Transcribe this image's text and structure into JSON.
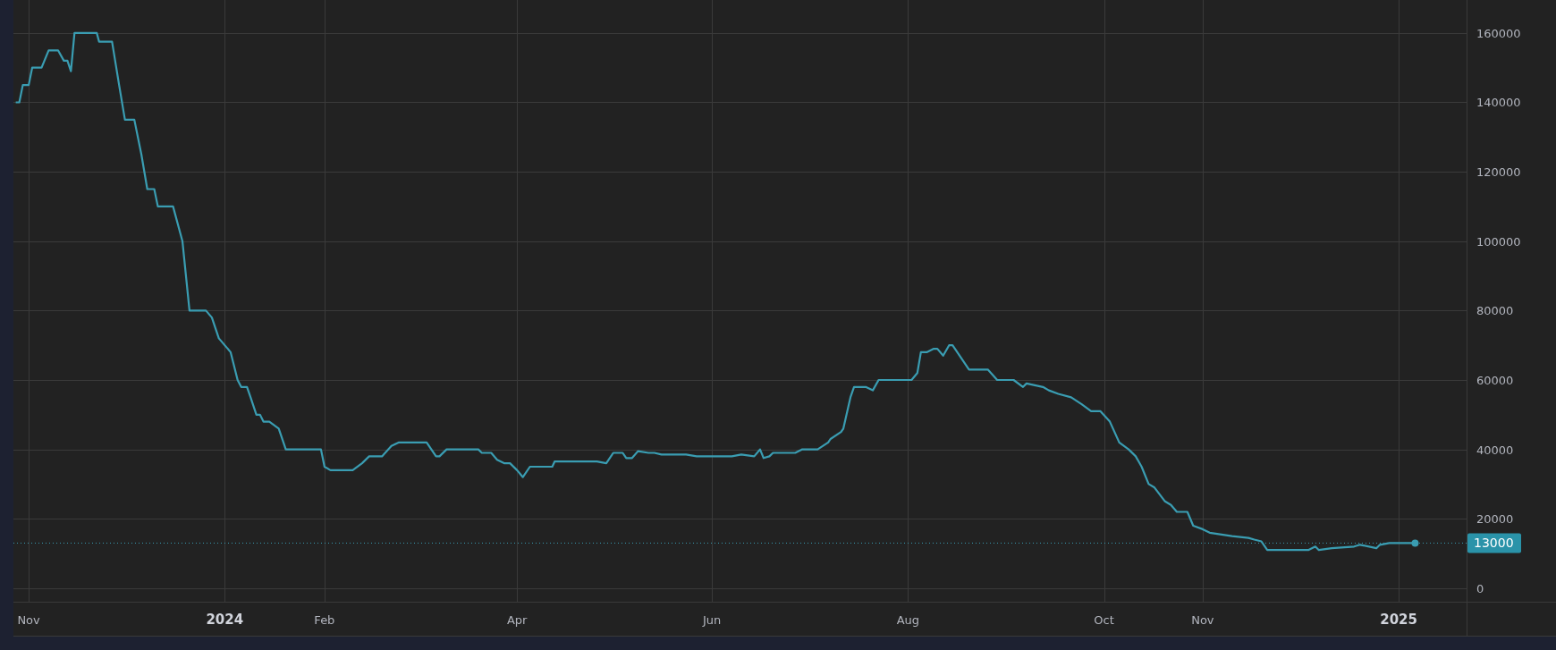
{
  "chart": {
    "x_tick_kinds": [
      {
        "kind": "month"
      },
      {
        "kind": "year"
      },
      {
        "kind": "month"
      },
      {
        "kind": "month"
      },
      {
        "kind": "month"
      },
      {
        "kind": "month"
      },
      {
        "kind": "month"
      },
      {
        "kind": "month"
      },
      {
        "kind": "year"
      }
    ],
    "chart_data": {
      "type": "line",
      "xlim": [
        2023.82,
        2025.134
      ],
      "ylim": [
        -3900,
        169500
      ],
      "xticks": [
        {
          "value": 2023.833,
          "label": "Nov"
        },
        {
          "value": 2024,
          "label": "2024"
        },
        {
          "value": 2024.085,
          "label": "Feb"
        },
        {
          "value": 2024.249,
          "label": "Apr"
        },
        {
          "value": 2024.415,
          "label": "Jun"
        },
        {
          "value": 2024.582,
          "label": "Aug"
        },
        {
          "value": 2024.749,
          "label": "Oct"
        },
        {
          "value": 2024.833,
          "label": "Nov"
        },
        {
          "value": 2025,
          "label": "2025"
        }
      ],
      "yticks": [
        0,
        20000,
        40000,
        60000,
        80000,
        100000,
        120000,
        140000,
        160000
      ],
      "series": [
        {
          "color": "#3a9db2",
          "x": [
            2023.822,
            2023.825,
            2023.828,
            2023.833,
            2023.836,
            2023.844,
            2023.85,
            2023.858,
            2023.863,
            2023.866,
            2023.869,
            2023.872,
            2023.891,
            2023.893,
            2023.904,
            2023.91,
            2023.915,
            2023.923,
            2023.929,
            2023.934,
            2023.94,
            2023.943,
            2023.956,
            2023.964,
            2023.97,
            2023.984,
            2023.989,
            2023.995,
            2024.005,
            2024.011,
            2024.014,
            2024.019,
            2024.022,
            2024.027,
            2024.03,
            2024.033,
            2024.038,
            2024.046,
            2024.052,
            2024.082,
            2024.085,
            2024.09,
            2024.109,
            2024.117,
            2024.123,
            2024.134,
            2024.142,
            2024.148,
            2024.172,
            2024.18,
            2024.183,
            2024.189,
            2024.216,
            2024.219,
            2024.227,
            2024.232,
            2024.238,
            2024.243,
            2024.249,
            2024.254,
            2024.26,
            2024.279,
            2024.281,
            2024.317,
            2024.325,
            2024.331,
            2024.339,
            2024.342,
            2024.347,
            2024.352,
            2024.361,
            2024.366,
            2024.372,
            2024.393,
            2024.402,
            2024.432,
            2024.44,
            2024.451,
            2024.456,
            2024.459,
            2024.464,
            2024.467,
            2024.486,
            2024.492,
            2024.505,
            2024.514,
            2024.516,
            2024.525,
            2024.527,
            2024.533,
            2024.536,
            2024.546,
            2024.552,
            2024.557,
            2024.585,
            2024.59,
            2024.593,
            2024.598,
            2024.604,
            2024.607,
            2024.612,
            2024.617,
            2024.62,
            2024.634,
            2024.65,
            2024.658,
            2024.672,
            2024.68,
            2024.683,
            2024.697,
            2024.702,
            2024.71,
            2024.721,
            2024.73,
            2024.738,
            2024.746,
            2024.754,
            2024.762,
            2024.77,
            2024.776,
            2024.781,
            2024.787,
            2024.792,
            2024.801,
            2024.806,
            2024.811,
            2024.82,
            2024.825,
            2024.833,
            2024.839,
            2024.858,
            2024.872,
            2024.877,
            2024.883,
            2024.888,
            2024.923,
            2024.929,
            2024.932,
            2024.943,
            2024.962,
            2024.967,
            2024.981,
            2024.984,
            2024.992,
            2025.014
          ],
          "values": [
            140000,
            140000,
            145000,
            145000,
            150000,
            150000,
            155000,
            155000,
            152000,
            152000,
            149000,
            160000,
            160000,
            157500,
            157500,
            145000,
            135000,
            135000,
            125000,
            115000,
            115000,
            110000,
            110000,
            100000,
            80000,
            80000,
            78000,
            72000,
            68000,
            60000,
            58000,
            58000,
            55000,
            50000,
            50000,
            48000,
            48000,
            46000,
            40000,
            40000,
            35000,
            34000,
            34000,
            36000,
            38000,
            38000,
            41000,
            42000,
            42000,
            38000,
            38000,
            40000,
            40000,
            39000,
            39000,
            37000,
            36000,
            36000,
            34000,
            32000,
            35000,
            35000,
            36500,
            36500,
            36000,
            39000,
            39000,
            37500,
            37500,
            39500,
            39000,
            39000,
            38500,
            38500,
            38000,
            38000,
            38500,
            38000,
            40000,
            37500,
            38000,
            39000,
            39000,
            40000,
            40000,
            42000,
            43000,
            45000,
            46000,
            55000,
            58000,
            58000,
            57000,
            60000,
            60000,
            62000,
            68000,
            68000,
            69000,
            69000,
            67000,
            70000,
            70000,
            63000,
            63000,
            60000,
            60000,
            58000,
            59000,
            58000,
            57000,
            56000,
            55000,
            53000,
            51000,
            51000,
            48000,
            42000,
            40000,
            38000,
            35000,
            30000,
            29000,
            25000,
            24000,
            22000,
            22000,
            18000,
            17000,
            16000,
            15000,
            14500,
            14000,
            13500,
            11000,
            11000,
            12000,
            11000,
            11500,
            12000,
            12500,
            11500,
            12500,
            13000,
            13000
          ]
        }
      ],
      "ref_lines": [
        {
          "axis": "y",
          "value": 13000,
          "label": "13000",
          "color": "#3a9db2"
        }
      ],
      "grid": true
    }
  }
}
